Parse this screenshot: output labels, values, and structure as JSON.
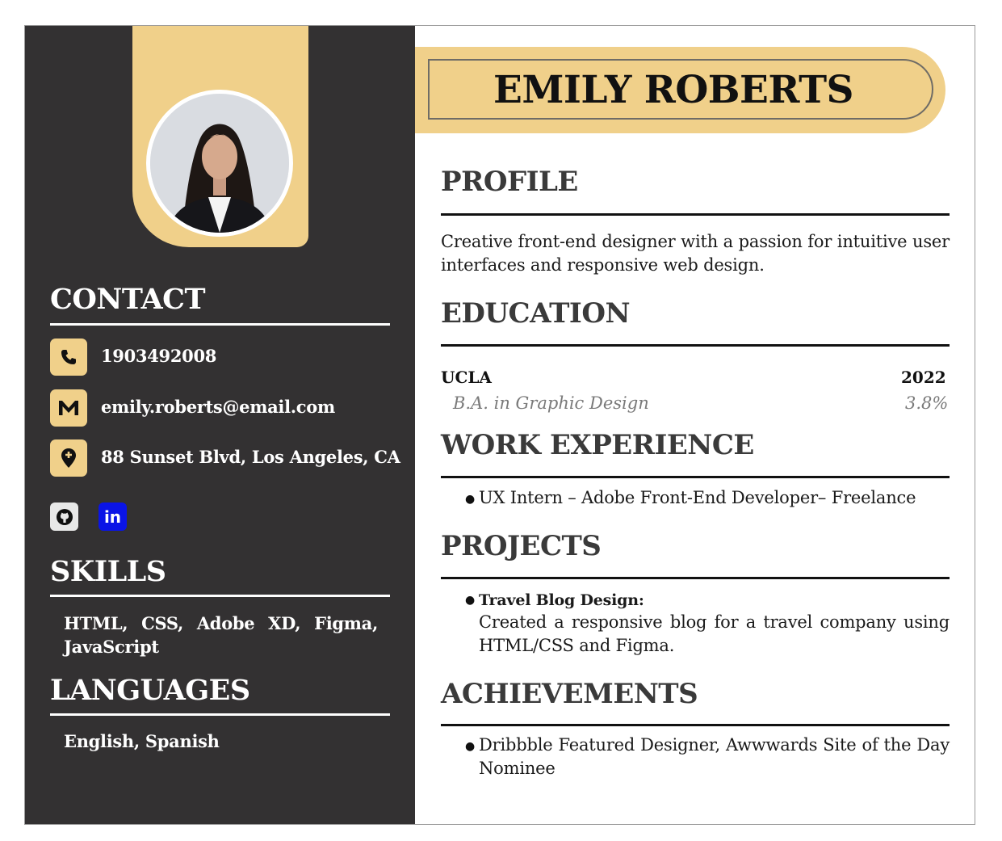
{
  "name": "EMILY ROBERTS",
  "colors": {
    "accent": "#f0d08a",
    "sidebar": "#333132",
    "linkedin": "#0a14e6"
  },
  "sidebar": {
    "contact": {
      "heading": "CONTACT",
      "phone": "1903492008",
      "email": "emily.roberts@email.com",
      "address": "88 Sunset Blvd, Los Angeles, CA",
      "icons": [
        "phone-icon",
        "email-icon",
        "location-icon"
      ],
      "social_icons": [
        "github-icon",
        "linkedin-icon"
      ],
      "linkedin_glyph": "in"
    },
    "skills": {
      "heading": "SKILLS",
      "text": "HTML, CSS, Adobe XD, Figma, JavaScript"
    },
    "languages": {
      "heading": "LANGUAGES",
      "text": "English, Spanish"
    }
  },
  "main": {
    "profile": {
      "heading": "PROFILE",
      "text": "Creative front-end designer with a passion for intuitive user interfaces and responsive web design."
    },
    "education": {
      "heading": "EDUCATION",
      "school": "UCLA",
      "year": "2022",
      "degree": "B.A. in Graphic Design",
      "gpa": "3.8%"
    },
    "work": {
      "heading": "WORK EXPERIENCE",
      "items": [
        "UX Intern – Adobe Front-End Developer– Freelance"
      ]
    },
    "projects": {
      "heading": "PROJECTS",
      "title": "Travel Blog Design:",
      "description": "Created a responsive blog for a travel company using HTML/CSS and Figma."
    },
    "achievements": {
      "heading": "ACHIEVEMENTS",
      "items": [
        "Dribbble Featured Designer, Awwwards Site of the Day Nominee"
      ]
    }
  }
}
